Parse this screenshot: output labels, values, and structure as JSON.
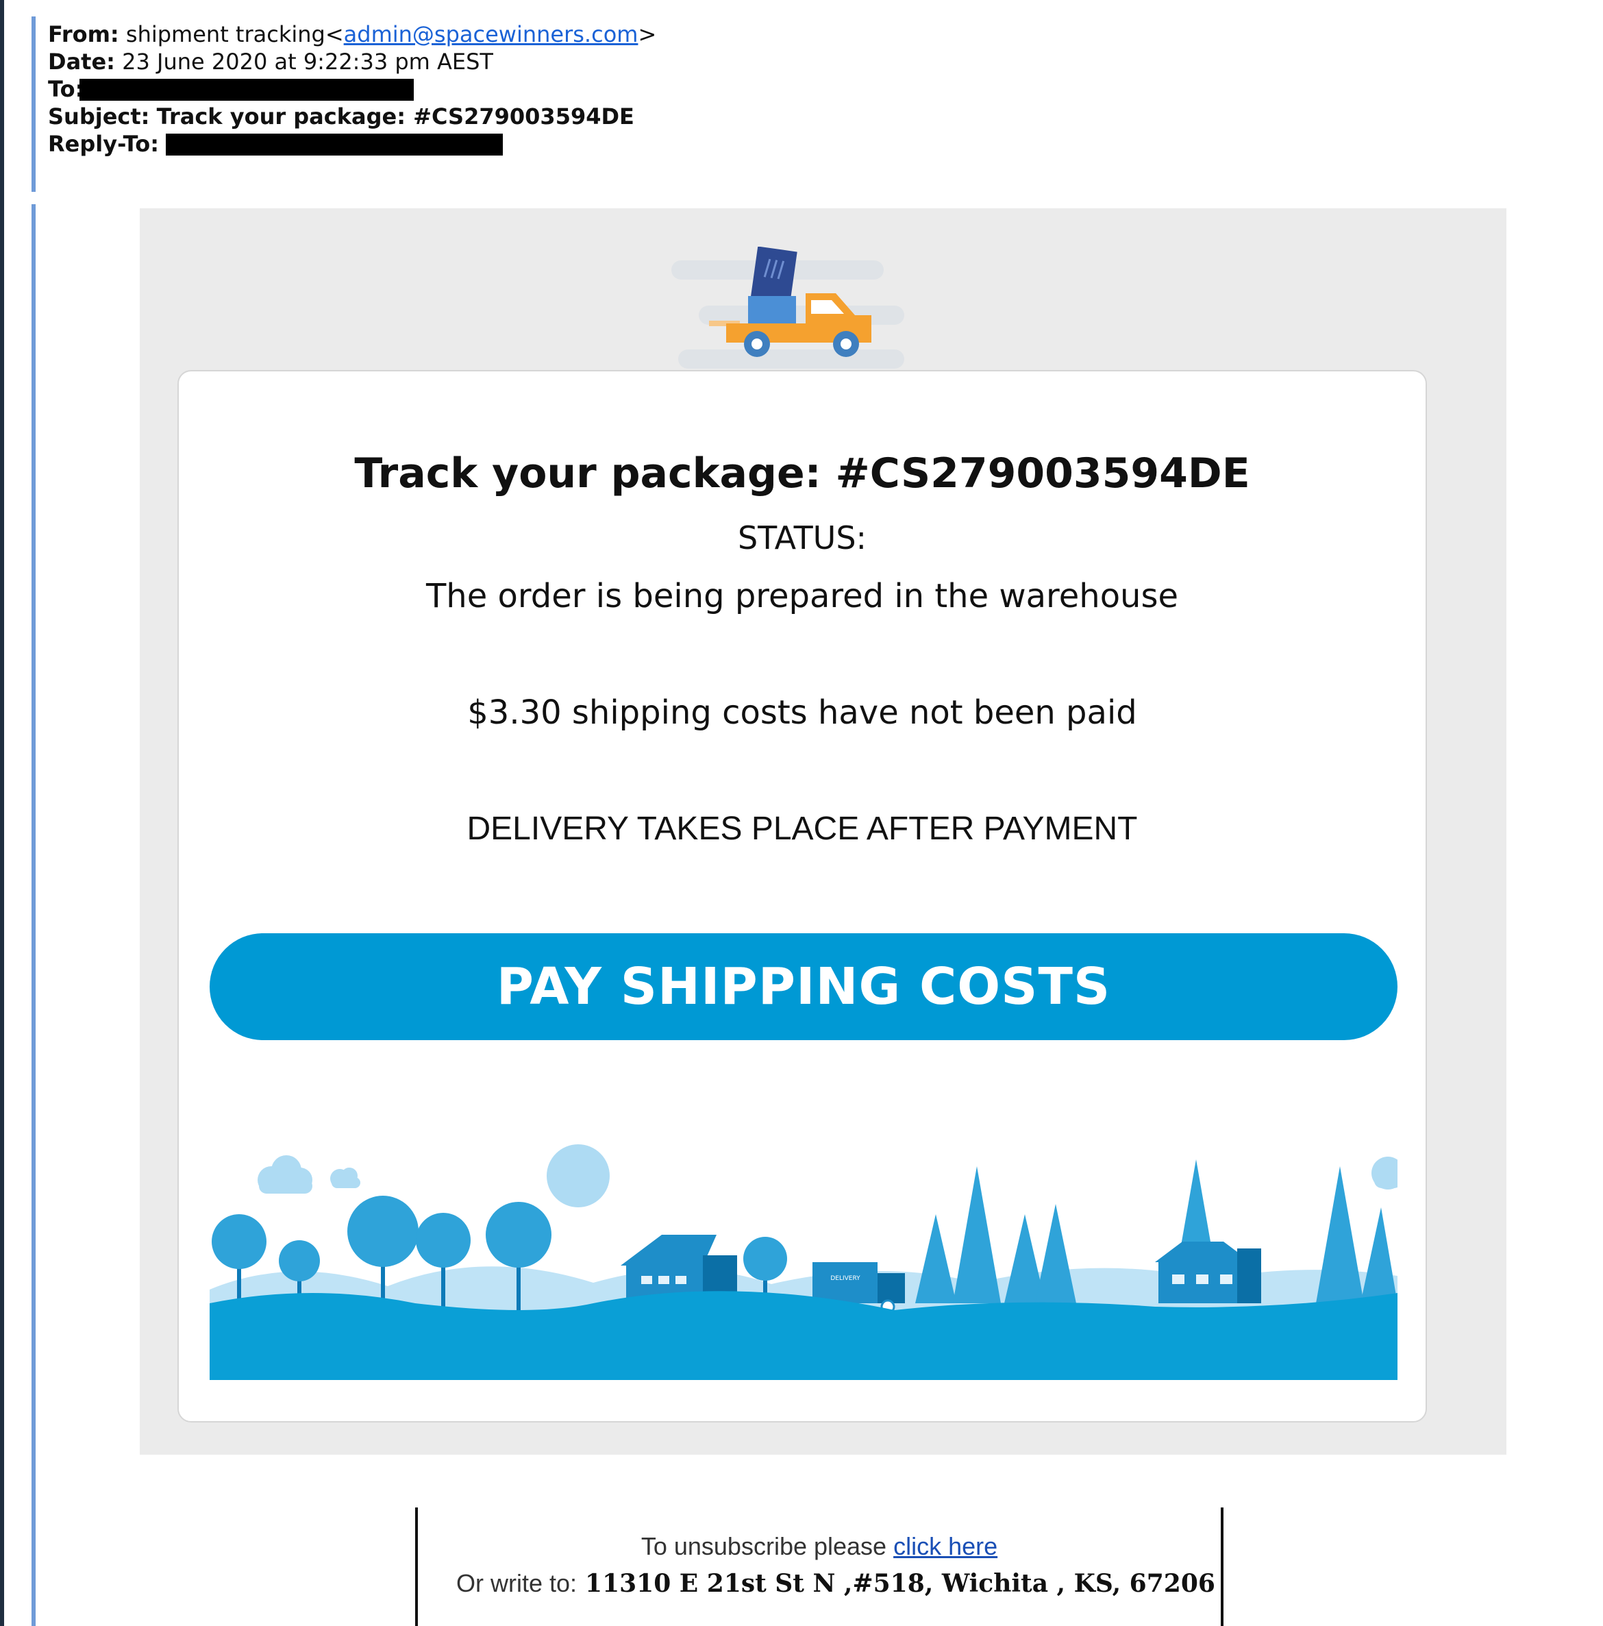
{
  "header": {
    "from_label": "From:",
    "from_name": "shipment tracking<",
    "from_email": "admin@spacewinners.com",
    "from_close": ">",
    "date_label": "Date:",
    "date_value": "23 June 2020 at 9:22:33 pm AEST",
    "to_label": "To:",
    "subject_label": "Subject:",
    "subject_value": "Track your package: #CS279003594DE",
    "reply_to_label": "Reply-To:"
  },
  "email": {
    "title": "Track your package: #CS279003594DE",
    "status_label": "STATUS:",
    "status_message": "The order is being prepared in the warehouse",
    "cost_message": "$3.30 shipping costs have not been paid",
    "delivery_notice": "DELIVERY TAKES PLACE AFTER PAYMENT",
    "pay_button": "PAY SHIPPING COSTS",
    "truck_label": "DELIVERY"
  },
  "footer": {
    "unsubscribe_text": "To unsubscribe please ",
    "unsubscribe_link": "click here",
    "write_label": "Or write to:",
    "address": "11310 E 21st St N ,#518, Wichita , KS, 67206"
  },
  "colors": {
    "button": "#0099d4",
    "link": "#1a62d6",
    "truck_body": "#f5a12f",
    "scene_blue": "#0a9fd6"
  }
}
